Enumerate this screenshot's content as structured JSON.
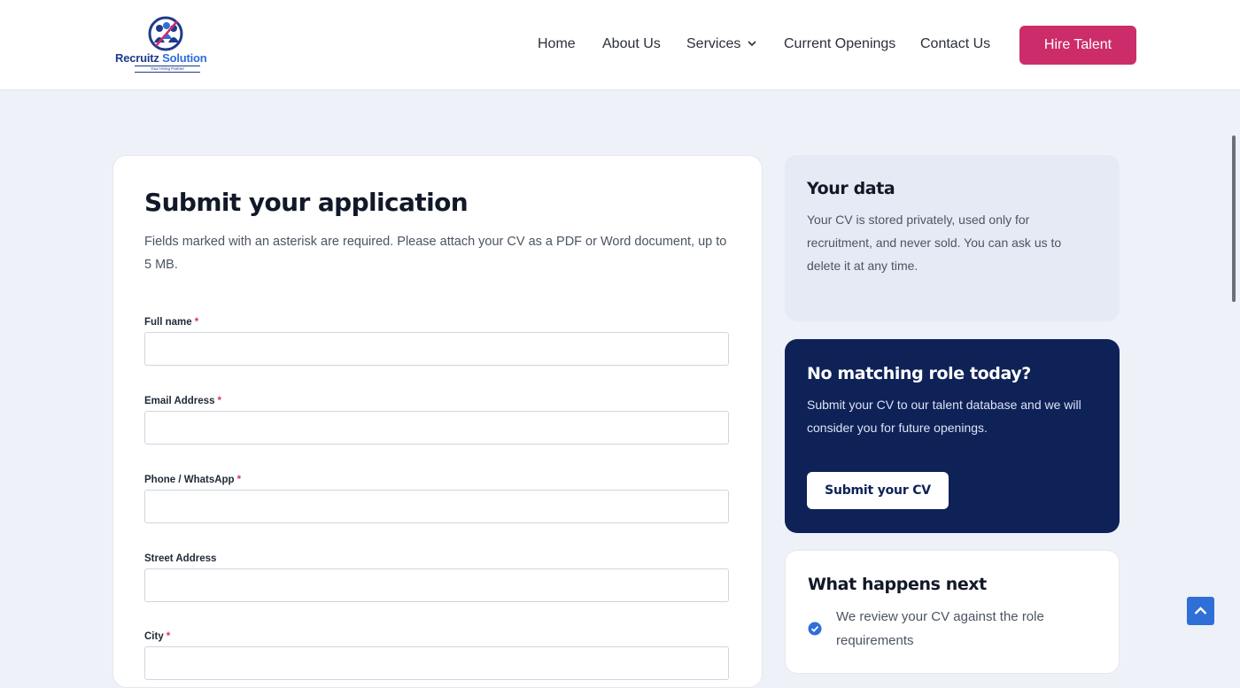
{
  "header": {
    "logo": {
      "name_part1": "Recruitz",
      "name_part2": "Solution",
      "tagline": "Your Hiring Partner"
    },
    "nav": [
      {
        "label": "Home"
      },
      {
        "label": "About Us"
      },
      {
        "label": "Services",
        "has_dropdown": true
      },
      {
        "label": "Current Openings"
      },
      {
        "label": "Contact Us"
      }
    ],
    "cta_label": "Hire Talent"
  },
  "form": {
    "title": "Submit your application",
    "intro": "Fields marked with an asterisk are required. Please attach your CV as a PDF or Word document, up to 5 MB.",
    "required_marker": "*",
    "fields": [
      {
        "label": "Full name",
        "required": true,
        "value": ""
      },
      {
        "label": "Email Address",
        "required": true,
        "value": ""
      },
      {
        "label": "Phone / WhatsApp",
        "required": true,
        "value": ""
      },
      {
        "label": "Street Address",
        "required": false,
        "value": ""
      },
      {
        "label": "City",
        "required": true,
        "value": ""
      }
    ]
  },
  "sidebar": {
    "your_data": {
      "title": "Your data",
      "text": "Your CV is stored privately, used only for recruitment, and never sold. You can ask us to delete it at any time."
    },
    "no_role": {
      "title": "No matching role today?",
      "text": "Submit your CV to our talent database and we will consider you for future openings.",
      "button_label": "Submit your CV"
    },
    "next": {
      "title": "What happens next",
      "steps": [
        {
          "text": "We review your CV against the role requirements"
        }
      ]
    }
  },
  "colors": {
    "brand_pink": "#cc2d6a",
    "navy": "#0e2257",
    "accent_blue": "#2f6fd8",
    "page_bg": "#eef1f8"
  },
  "icons": {
    "dropdown": "chevron-down-icon",
    "step": "check-circle-icon",
    "back_to_top": "chevron-up-icon"
  }
}
